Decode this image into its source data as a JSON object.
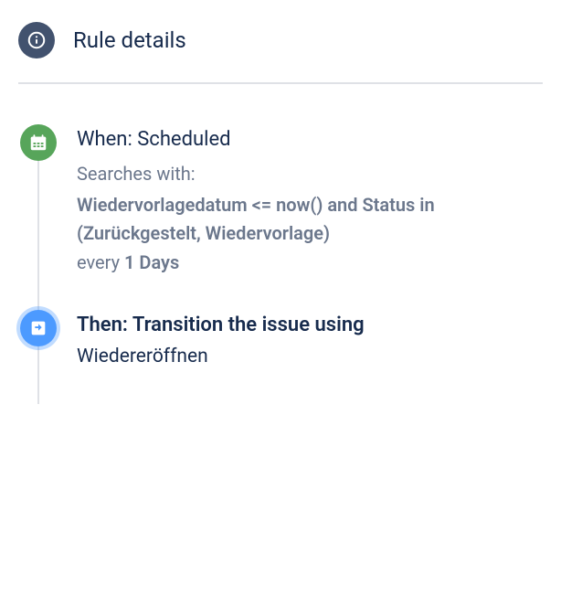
{
  "header": {
    "title": "Rule details"
  },
  "steps": {
    "trigger": {
      "title": "When: Scheduled",
      "searches_label": "Searches with:",
      "query": "Wiedervorlagedatum <= now() and Status in (Zurückgestelt, Wiedervorlage)",
      "freq_prefix": "every ",
      "freq_value": "1 Days"
    },
    "action": {
      "title": "Then: Transition the issue using",
      "transition": "Wiedereröffnen"
    }
  },
  "icons": {
    "info": "info-icon",
    "calendar": "calendar-icon",
    "transition": "transition-icon"
  },
  "colors": {
    "info_bg": "#42526E",
    "trigger_bg": "#57A55A",
    "action_bg": "#4C9AFF",
    "action_glow": "rgba(76,154,255,0.35)"
  }
}
